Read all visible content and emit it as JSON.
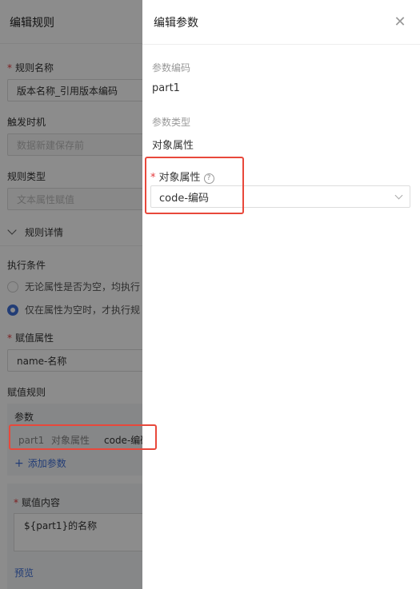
{
  "left": {
    "title": "编辑规则",
    "rule_name_label": "规则名称",
    "rule_name_value": "版本名称_引用版本编码",
    "trigger_label": "触发时机",
    "trigger_value": "数据新建保存前",
    "rule_type_label": "规则类型",
    "rule_type_value": "文本属性赋值",
    "details_label": "规则详情",
    "condition_label": "执行条件",
    "condition_options": [
      "无论属性是否为空，均执行",
      "仅在属性为空时，才执行规"
    ],
    "assign_attr_label": "赋值属性",
    "assign_attr_value": "name-名称",
    "assign_rule_label": "赋值规则",
    "params_label": "参数",
    "param_row": {
      "code": "part1",
      "type": "对象属性",
      "value": "code-编码"
    },
    "add_param": "添加参数",
    "assign_content_label": "赋值内容",
    "assign_content_value": "${part1}的名称",
    "preview": "预览"
  },
  "drawer": {
    "title": "编辑参数",
    "param_code_label": "参数编码",
    "param_code_value": "part1",
    "param_type_label": "参数类型",
    "param_type_value": "对象属性",
    "object_attr_label": "对象属性",
    "object_attr_value": "code-编码"
  },
  "colors": {
    "accent": "#3f6fd8",
    "highlight": "#e8483b",
    "required": "#e4393c"
  }
}
